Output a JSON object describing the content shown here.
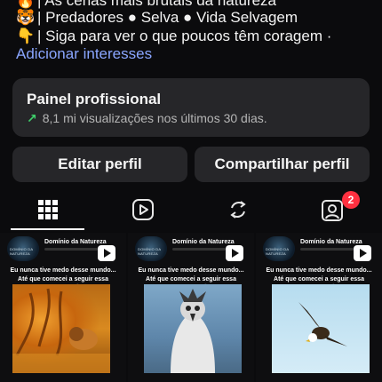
{
  "bio": [
    {
      "icon": "flame-emoji-icon",
      "glyph": "🔥",
      "text": "| As cenas mais brutais da natureza"
    },
    {
      "icon": "tiger-emoji-icon",
      "glyph": "🐯",
      "text": "| Predadores ● Selva ● Vida Selvagem"
    },
    {
      "icon": "pointing-down-emoji-icon",
      "glyph": "👇",
      "text": "| Siga para ver o que poucos têm coragem ·"
    }
  ],
  "add_interests": "Adicionar interesses",
  "panel": {
    "title": "Painel profissional",
    "arrow": "↗",
    "subtitle": "8,1 mi visualizações nos últimos 30 dias."
  },
  "buttons": {
    "edit": "Editar perfil",
    "share": "Compartilhar perfil"
  },
  "tabs": {
    "tagged_badge": "2",
    "active": "grid"
  },
  "posts": [
    {
      "account": "Domínio da Natureza",
      "avatar_text": "DOMÍNIO DA NATUREZA",
      "caption": "Eu nunca tive medo desse mundo... Até que comecei a seguir essa página 🙈💀",
      "image": "lion-in-orange-water"
    },
    {
      "account": "Domínio da Natureza",
      "avatar_text": "DOMÍNIO DA NATUREZA",
      "caption": "Eu nunca tive medo desse mundo... Até que comecei a seguir essa página 🙈💀",
      "image": "harpy-eagle-closeup"
    },
    {
      "account": "Domínio da Natureza",
      "avatar_text": "DOMÍNIO DA NATUREZA",
      "caption": "Eu nunca tive medo desse mundo... Até que comecei a seguir essa página 🙈💀",
      "image": "bald-eagle-flying"
    }
  ],
  "colors": {
    "background": "#0b0b0d",
    "surface": "#262629",
    "link": "#8aa6ff",
    "growth": "#3fd06b",
    "badge": "#ff3040"
  }
}
